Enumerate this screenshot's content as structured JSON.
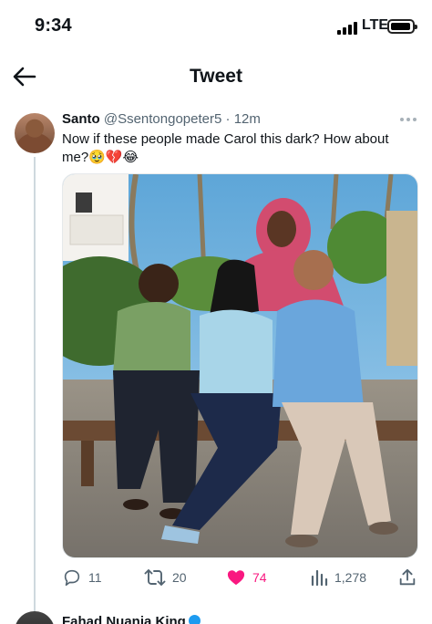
{
  "status_bar": {
    "time": "9:34",
    "network": "LTE",
    "icons": [
      "signal-icon",
      "battery-icon"
    ]
  },
  "header": {
    "back_icon": "back-arrow-icon",
    "title": "Tweet"
  },
  "tweet": {
    "author_name": "Santo",
    "author_handle": "@Ssentongopeter5",
    "separator": "·",
    "time_ago": "12m",
    "text": "Now if these people made Carol this dark? How about me?🥹💔😂",
    "more_icon": "more-dots-icon",
    "media": {
      "type": "photo",
      "alt_icon": "photo-of-four-people-on-bench"
    }
  },
  "actions": {
    "reply": {
      "icon": "reply-icon",
      "count": "11"
    },
    "retweet": {
      "icon": "retweet-icon",
      "count": "20"
    },
    "like": {
      "icon": "heart-icon",
      "count": "74",
      "active": true
    },
    "views": {
      "icon": "views-icon",
      "count": "1,278"
    },
    "share": {
      "icon": "share-icon"
    }
  },
  "next_tweet": {
    "author_name": "Fahad Nuania King"
  },
  "colors": {
    "text": "#0f1419",
    "secondary": "#536471",
    "like": "#f91880",
    "divider": "#cfd9de",
    "verified": "#1d9bf0"
  }
}
